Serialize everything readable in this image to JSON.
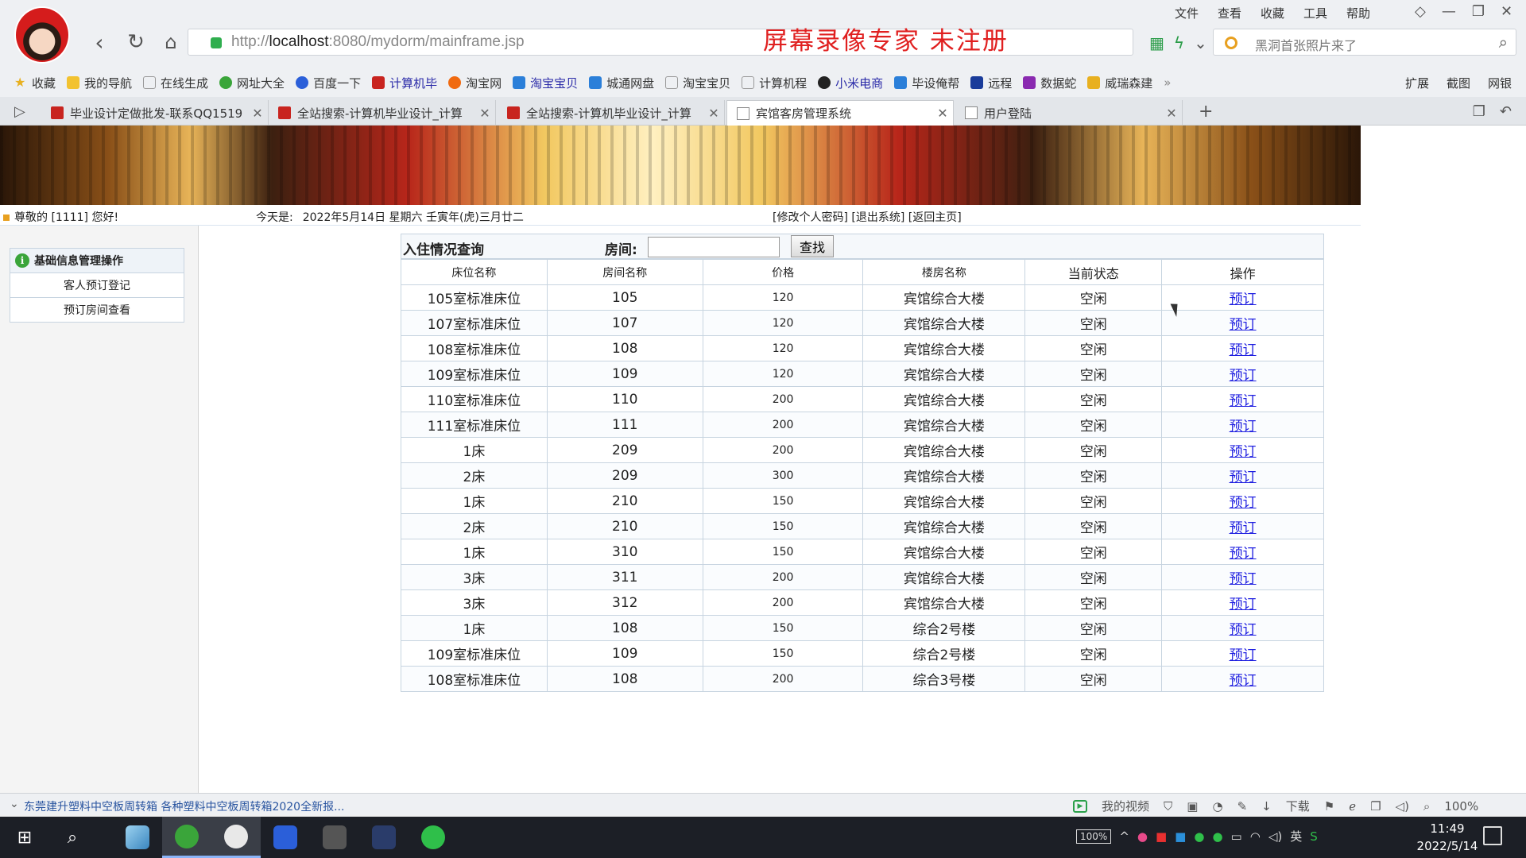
{
  "browser": {
    "url_host": "http://",
    "url_domain": "localhost",
    "url_rest": ":8080/mydorm/mainframe.jsp",
    "watermark": "屏幕录像专家  未注册",
    "search_placeholder": "黑洞首张照片来了",
    "menu": [
      "文件",
      "查看",
      "收藏",
      "工具",
      "帮助"
    ],
    "bookmarks": [
      "收藏",
      "我的导航",
      "在线生成",
      "网址大全",
      "百度一下",
      "计算机毕",
      "淘宝网",
      "淘宝宝贝",
      "城通网盘",
      "淘宝宝贝",
      "计算机程",
      "小米电商",
      "毕设俺帮",
      "远程",
      "数据蛇",
      "威瑞森建"
    ],
    "bookmarks_right": [
      "扩展",
      "截图",
      "网银"
    ],
    "tabs": [
      {
        "label": "毕业设计定做批发-联系QQ1519",
        "icon": "red"
      },
      {
        "label": "全站搜索-计算机毕业设计_计算",
        "icon": "red"
      },
      {
        "label": "全站搜索-计算机毕业设计_计算",
        "icon": "red"
      },
      {
        "label": "宾馆客房管理系统",
        "icon": "doc"
      },
      {
        "label": "用户登陆",
        "icon": "doc"
      }
    ]
  },
  "header": {
    "greeting": "尊敬的 [1111] 您好!",
    "today_label": "今天是:",
    "today_value": "2022年5月14日 星期六 壬寅年(虎)三月廿二",
    "links": "[修改个人密码] [退出系统] [返回主页]"
  },
  "sidebar": {
    "title": "基础信息管理操作",
    "items": [
      "客人预订登记",
      "预订房间查看"
    ]
  },
  "query": {
    "title": "入住情况查询",
    "room_label": "房间:",
    "search_button": "查找",
    "room_value": ""
  },
  "table": {
    "columns": [
      "床位名称",
      "房间名称",
      "价格",
      "楼房名称",
      "当前状态",
      "操作"
    ],
    "rows": [
      [
        "105室标准床位",
        "105",
        "120",
        "宾馆综合大楼",
        "空闲",
        "预订"
      ],
      [
        "107室标准床位",
        "107",
        "120",
        "宾馆综合大楼",
        "空闲",
        "预订"
      ],
      [
        "108室标准床位",
        "108",
        "120",
        "宾馆综合大楼",
        "空闲",
        "预订"
      ],
      [
        "109室标准床位",
        "109",
        "120",
        "宾馆综合大楼",
        "空闲",
        "预订"
      ],
      [
        "110室标准床位",
        "110",
        "200",
        "宾馆综合大楼",
        "空闲",
        "预订"
      ],
      [
        "111室标准床位",
        "111",
        "200",
        "宾馆综合大楼",
        "空闲",
        "预订"
      ],
      [
        "1床",
        "209",
        "200",
        "宾馆综合大楼",
        "空闲",
        "预订"
      ],
      [
        "2床",
        "209",
        "300",
        "宾馆综合大楼",
        "空闲",
        "预订"
      ],
      [
        "1床",
        "210",
        "150",
        "宾馆综合大楼",
        "空闲",
        "预订"
      ],
      [
        "2床",
        "210",
        "150",
        "宾馆综合大楼",
        "空闲",
        "预订"
      ],
      [
        "1床",
        "310",
        "150",
        "宾馆综合大楼",
        "空闲",
        "预订"
      ],
      [
        "3床",
        "311",
        "200",
        "宾馆综合大楼",
        "空闲",
        "预订"
      ],
      [
        "3床",
        "312",
        "200",
        "宾馆综合大楼",
        "空闲",
        "预订"
      ],
      [
        "1床",
        "108",
        "150",
        "综合2号楼",
        "空闲",
        "预订"
      ],
      [
        "109室标准床位",
        "109",
        "150",
        "综合2号楼",
        "空闲",
        "预订"
      ],
      [
        "108室标准床位",
        "108",
        "200",
        "综合3号楼",
        "空闲",
        "预订"
      ]
    ]
  },
  "statusbar": {
    "ad": "东莞建升塑料中空板周转箱 各种塑料中空板周转箱2020全新报...",
    "my_video": "我的视频",
    "download": "下载",
    "zoom": "100%"
  },
  "taskbar": {
    "battery": "100%",
    "ime": "英",
    "time": "11:49",
    "date": "2022/5/14"
  },
  "colors": {
    "link": "#1e1ee0",
    "table_border": "#c7d4e0",
    "watermark": "#e02020"
  }
}
